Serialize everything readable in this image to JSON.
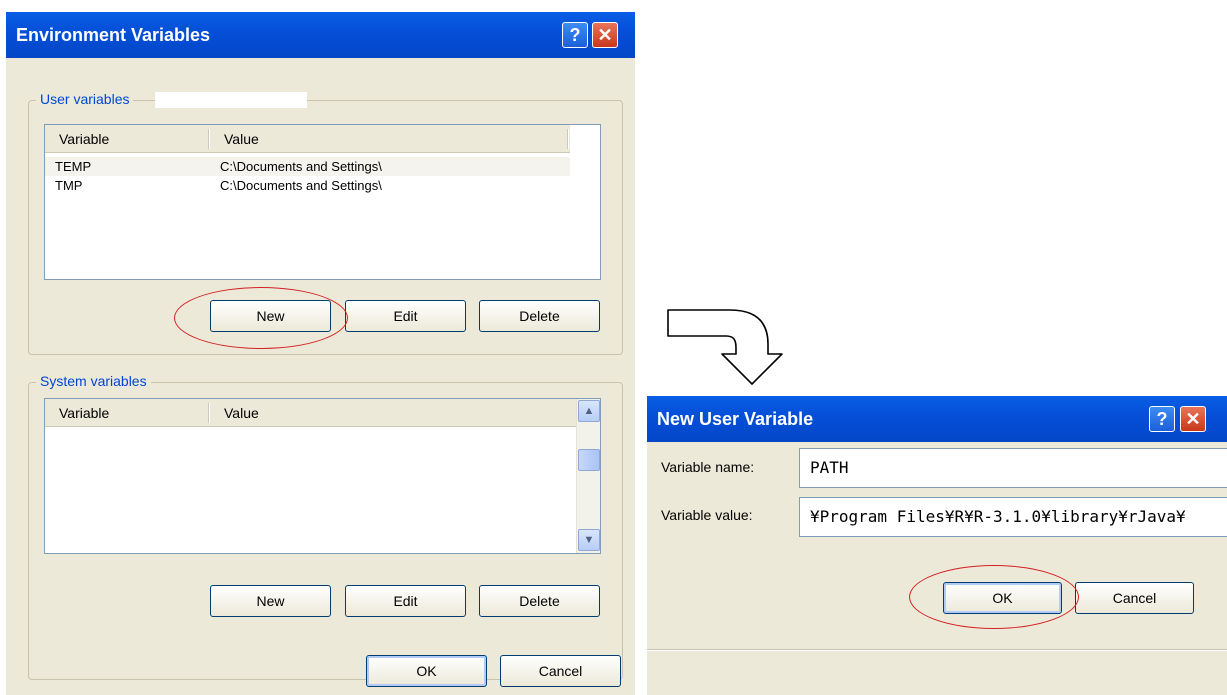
{
  "env_dialog": {
    "title": "Environment Variables",
    "help_glyph": "?",
    "close_glyph": "✕",
    "user_group_label": "User variables",
    "user_columns": [
      "Variable",
      "Value"
    ],
    "user_rows": [
      {
        "variable": "TEMP",
        "value": "C:\\Documents and Settings\\"
      },
      {
        "variable": "TMP",
        "value": "C:\\Documents and Settings\\"
      }
    ],
    "user_new": "New",
    "user_edit": "Edit",
    "user_delete": "Delete",
    "system_group_label": "System variables",
    "system_columns": [
      "Variable",
      "Value"
    ],
    "system_new": "New",
    "system_edit": "Edit",
    "system_delete": "Delete",
    "ok": "OK",
    "cancel": "Cancel"
  },
  "new_var_dialog": {
    "title": "New User Variable",
    "help_glyph": "?",
    "close_glyph": "✕",
    "name_label": "Variable name:",
    "name_value": "PATH",
    "value_label": "Variable value:",
    "value_value": "¥Program Files¥R¥R-3.1.0¥library¥rJava¥",
    "ok": "OK",
    "cancel": "Cancel"
  },
  "icons": {
    "scroll_up": "up-arrow-icon",
    "scroll_down": "down-arrow-icon",
    "transition_arrow": "curved-arrow-icon"
  },
  "colors": {
    "titlebar": "#0550d8",
    "dialog_bg": "#ece9d8",
    "highlight_ring": "#d42020",
    "group_label": "#0046d5"
  }
}
